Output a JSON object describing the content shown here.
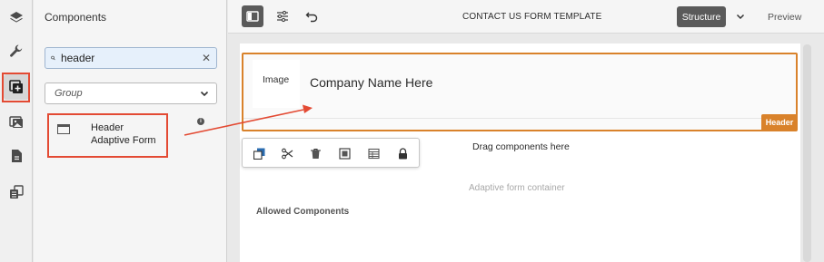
{
  "rail": {
    "items": [
      {
        "icon": "layers-icon"
      },
      {
        "icon": "wrench-icon"
      },
      {
        "icon": "add-component-icon",
        "active": true
      },
      {
        "icon": "assets-icon"
      },
      {
        "icon": "document-icon"
      },
      {
        "icon": "form-structure-icon"
      }
    ]
  },
  "panel": {
    "title": "Components",
    "search_value": "header",
    "clear_label": "✕",
    "group_placeholder": "Group",
    "result": {
      "name": "Header",
      "group": "Adaptive Form"
    },
    "info_label": "i"
  },
  "toolbar": {
    "doc_title": "CONTACT US FORM TEMPLATE",
    "structure_label": "Structure",
    "preview_label": "Preview"
  },
  "canvas": {
    "header_image_label": "Image",
    "company_text": "Company Name Here",
    "header_badge": "Header",
    "drag_here": "Drag components here",
    "container_label": "Adaptive form container",
    "allowed_label": "Allowed Components"
  },
  "colors": {
    "highlight": "#e34a33",
    "component_accent": "#d9822b",
    "edit_icon_blue": "#2b6cb0"
  }
}
